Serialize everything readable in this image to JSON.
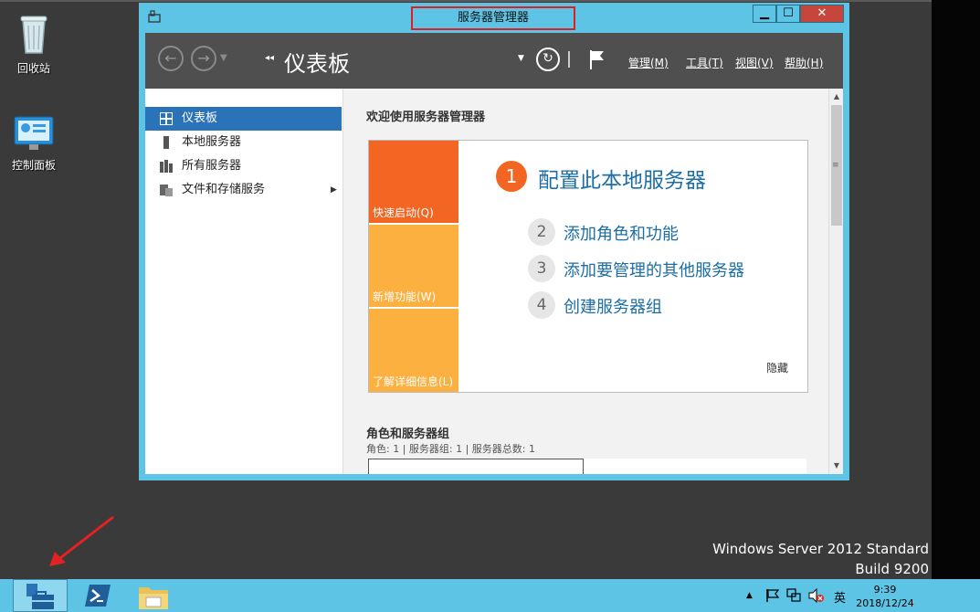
{
  "desktop": {
    "icons": [
      {
        "label": "回收站",
        "icon": "recycle-bin-icon"
      },
      {
        "label": "控制面板",
        "icon": "control-panel-icon"
      }
    ],
    "watermark_line1": "Windows Server 2012 Standard",
    "watermark_line2": "Build 9200"
  },
  "window": {
    "title": "服务器管理器",
    "controls": {
      "minimize": "▁",
      "maximize": "☐",
      "close": "✕"
    }
  },
  "header": {
    "breadcrumb_arrows": "◂◂",
    "title": "仪表板",
    "menus": [
      "管理(M)",
      "工具(T)",
      "视图(V)",
      "帮助(H)"
    ]
  },
  "sidebar": {
    "items": [
      {
        "label": "仪表板",
        "icon": "dashboard-icon",
        "active": true
      },
      {
        "label": "本地服务器",
        "icon": "local-server-icon",
        "active": false
      },
      {
        "label": "所有服务器",
        "icon": "all-servers-icon",
        "active": false
      },
      {
        "label": "文件和存储服务",
        "icon": "file-storage-icon",
        "active": false,
        "has_arrow": true
      }
    ]
  },
  "main": {
    "welcome": "欢迎使用服务器管理器",
    "tiles": [
      "快速启动(Q)",
      "新增功能(W)",
      "了解详细信息(L)"
    ],
    "primary_step": {
      "number": "1",
      "label": "配置此本地服务器"
    },
    "steps": [
      {
        "number": "2",
        "label": "添加角色和功能"
      },
      {
        "number": "3",
        "label": "添加要管理的其他服务器"
      },
      {
        "number": "4",
        "label": "创建服务器组"
      }
    ],
    "hide_label": "隐藏",
    "roles_title": "角色和服务器组",
    "roles_summary": "角色: 1 | 服务器组: 1 | 服务器总数: 1"
  },
  "taskbar": {
    "apps": [
      {
        "name": "server-manager",
        "active": true
      },
      {
        "name": "powershell",
        "active": false
      },
      {
        "name": "file-explorer",
        "active": false
      }
    ],
    "tray": {
      "ime": "英"
    },
    "clock": {
      "time": "9:39",
      "date": "2018/12/24"
    }
  },
  "colors": {
    "window_frame": "#5ec4e6",
    "header_bg": "#4f4f4f",
    "active_item": "#2b73b8",
    "quick_start": "#f26522",
    "tile_yellow": "#fbb040",
    "link_blue": "#1c6ea4",
    "highlight_box": "#e02020"
  }
}
